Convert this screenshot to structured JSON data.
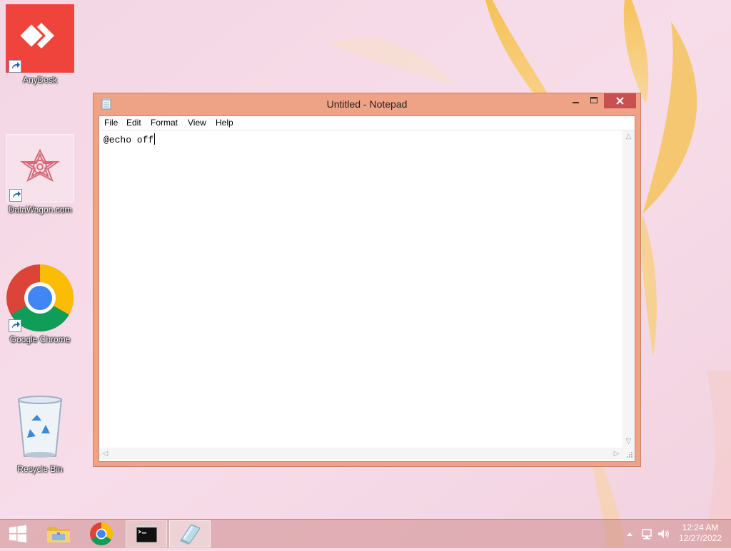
{
  "desktop": {
    "icons": [
      {
        "label": "AnyDesk"
      },
      {
        "label": "DataWagon.com"
      },
      {
        "label": "Google Chrome"
      },
      {
        "label": "Recycle Bin"
      }
    ]
  },
  "window": {
    "title": "Untitled - Notepad",
    "menu": [
      "File",
      "Edit",
      "Format",
      "View",
      "Help"
    ],
    "editor_text": "@echo off"
  },
  "taskbar": {
    "clock_time": "12:24 AM",
    "clock_date": "12/27/2022"
  },
  "colors": {
    "window_frame": "#eea286",
    "close_button": "#c75050",
    "anydesk_red": "#ef443b",
    "wallpaper": "#f6dbe7"
  },
  "icons": [
    "anydesk-icon",
    "datawagon-icon",
    "chrome-icon",
    "recycle-bin-icon",
    "notepad-icon",
    "windows-start-icon",
    "file-explorer-icon",
    "command-prompt-icon",
    "network-icon",
    "volume-icon"
  ]
}
